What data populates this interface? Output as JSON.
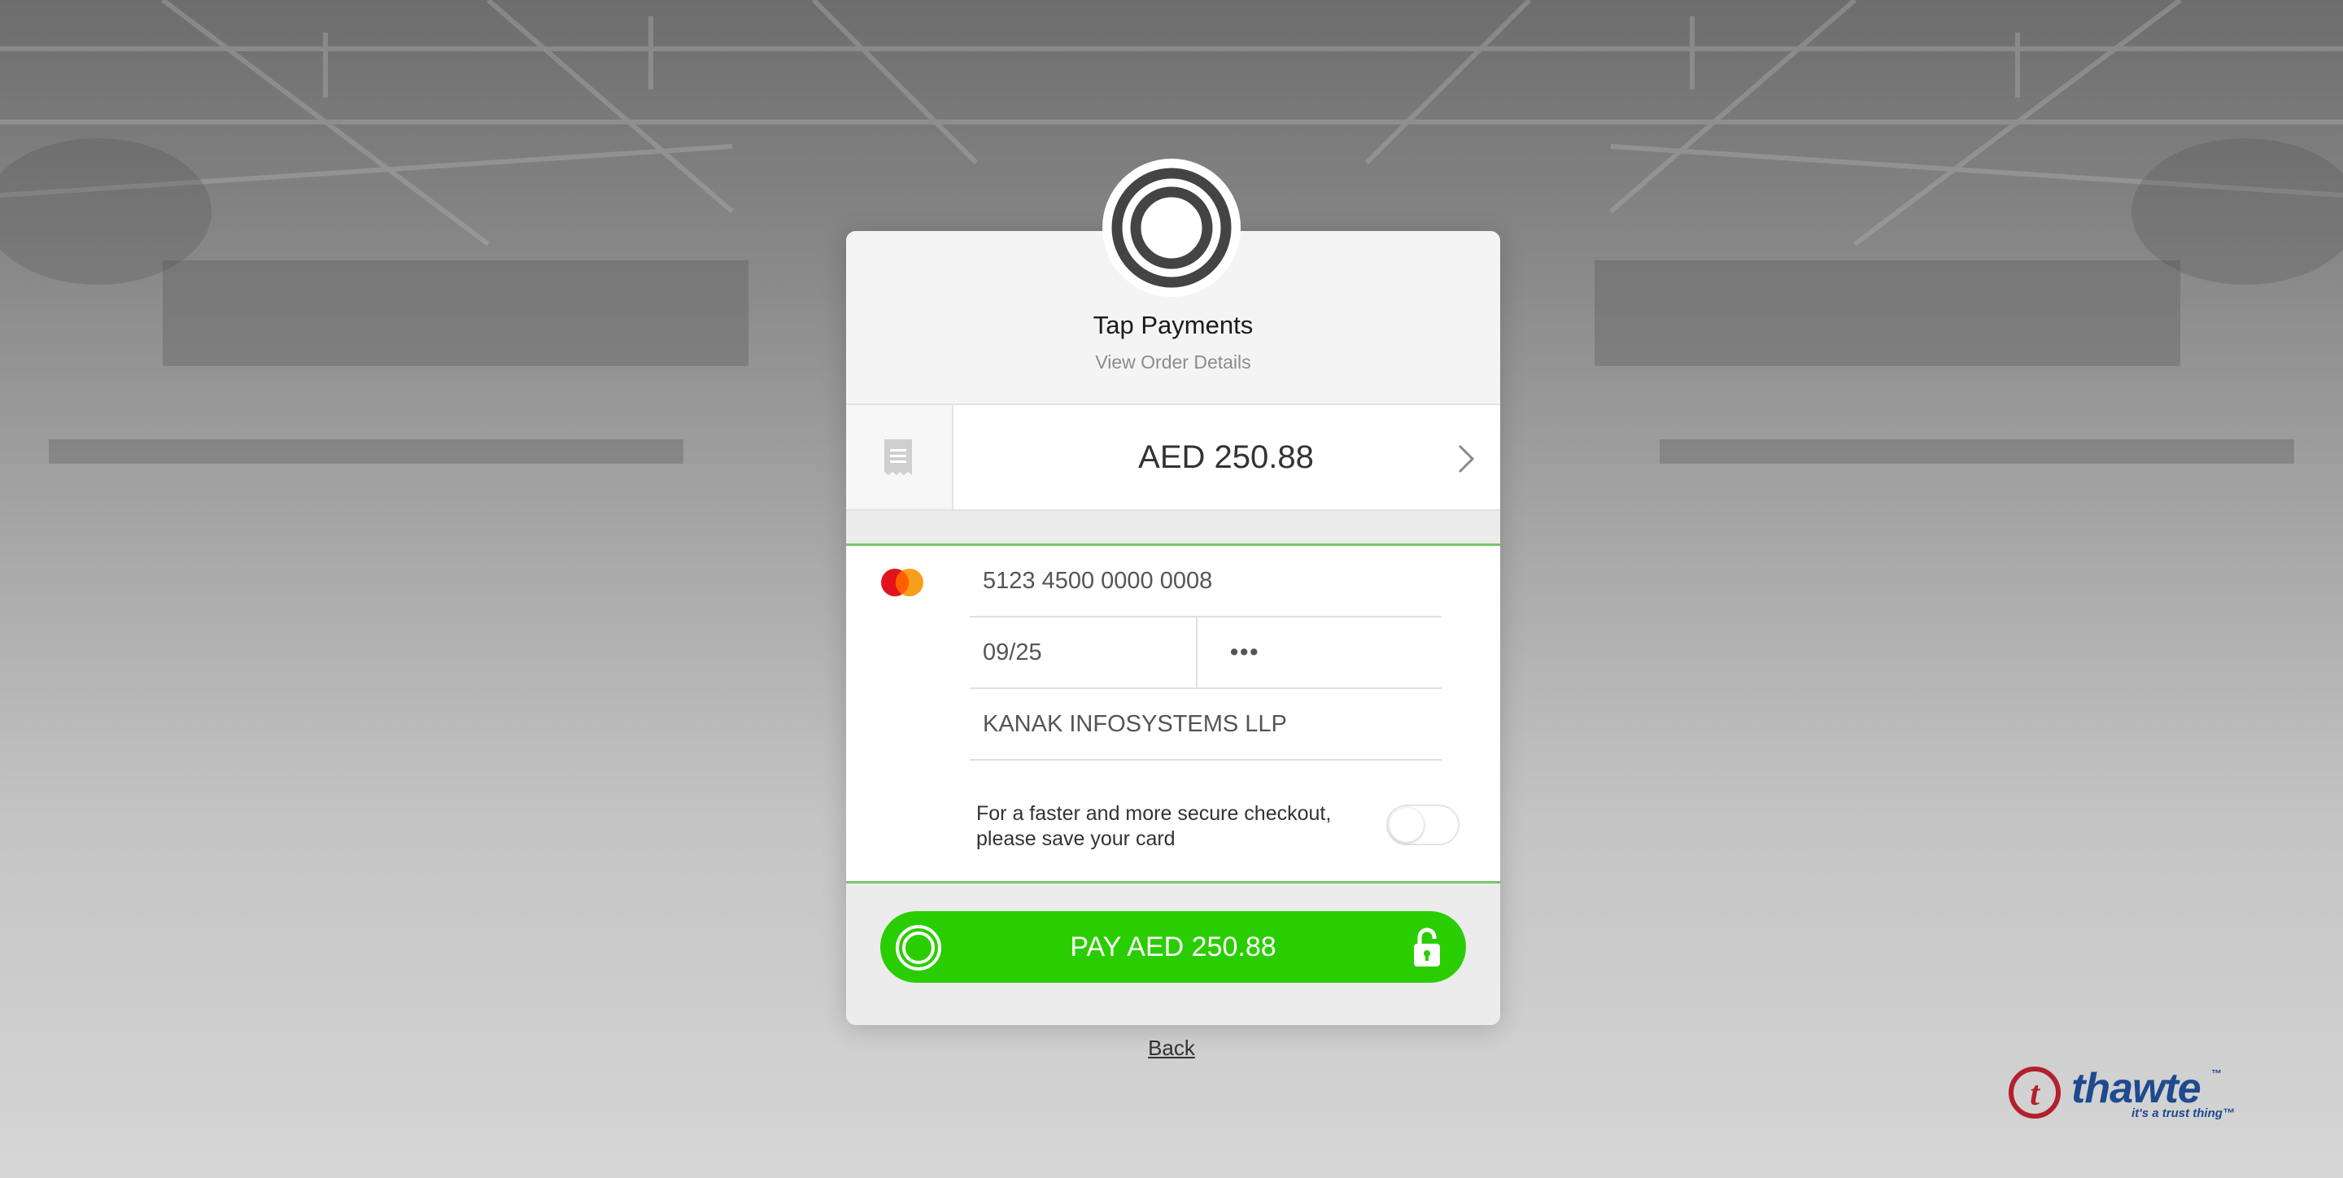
{
  "merchant": {
    "name": "Tap Payments",
    "view_order_label": "View Order Details"
  },
  "order": {
    "amount": "AED 250.88"
  },
  "card_form": {
    "card_number": "5123 4500 0000 0008",
    "expiry": "09/25",
    "cvv": "•••",
    "cardholder_name": "KANAK INFOSYSTEMS LLP",
    "card_brand": "mastercard-icon"
  },
  "save_card": {
    "text": "For a faster and more secure checkout, please save your card",
    "enabled": false
  },
  "pay_button": {
    "label": "PAY AED 250.88"
  },
  "back_link": "Back",
  "trust_badge": {
    "brand": "thawte",
    "tm": "™",
    "tagline": "it's a trust thing™"
  },
  "colors": {
    "pay_green": "#2ace00",
    "divider_green": "#74c866",
    "thawte_blue": "#1e4a8f",
    "thawte_red": "#b3202d"
  }
}
